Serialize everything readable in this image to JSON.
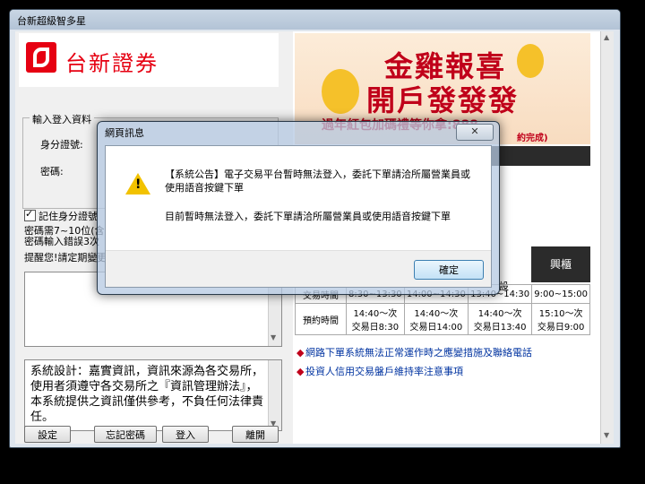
{
  "window": {
    "title": "台新超級智多星"
  },
  "left": {
    "logo_text": "台新證券",
    "login_legend": "輸入登入資料",
    "id_label": "身分證號:",
    "pwd_label": "密碼:",
    "remember_label": "記住身分證號",
    "pwd_rule1": "密碼需7~10位(含英",
    "pwd_rule2": "密碼輸入錯誤3次",
    "reminder": "提醒您!請定期變更",
    "system_info": "系統設計：嘉實資訊，資訊來源為各交易所，使用者須遵守各交易所之『資訊管理辦法』，本系統提供之資訊僅供參考，不負任何法律責任。",
    "buttons": {
      "settings": "設定",
      "forgot": "忘記密碼",
      "login": "登入",
      "exit": "離開"
    }
  },
  "banner": {
    "line1": "金雞報喜",
    "line2": "開戶發發發",
    "line3": "過年紅包加碼禮等你拿:888",
    "line3b": "約完成)"
  },
  "schedule": {
    "header_col": "興櫃",
    "header_partial": "設",
    "rows": [
      {
        "label": "交易時間",
        "cells": [
          "8:30~13:30",
          "14:00~14:30",
          "13:40~14:30",
          "9:00~15:00"
        ]
      },
      {
        "label": "預約時間",
        "cells": [
          "14:40～次\n交易日8:30",
          "14:40～次\n交易日14:00",
          "14:40～次\n交易日13:40",
          "15:10～次\n交易日9:00"
        ]
      }
    ]
  },
  "links": [
    "網路下單系統無法正常運作時之應變措施及聯絡電話",
    "投資人信用交易盤戶維持率注意事項"
  ],
  "dialog": {
    "title": "網頁訊息",
    "message1": "【系統公告】電子交易平台暫時無法登入，委託下單請洽所屬營業員或使用語音按鍵下單",
    "message2": "目前暫時無法登入，委託下單請洽所屬營業員或使用語音按鍵下單",
    "ok": "確定"
  }
}
